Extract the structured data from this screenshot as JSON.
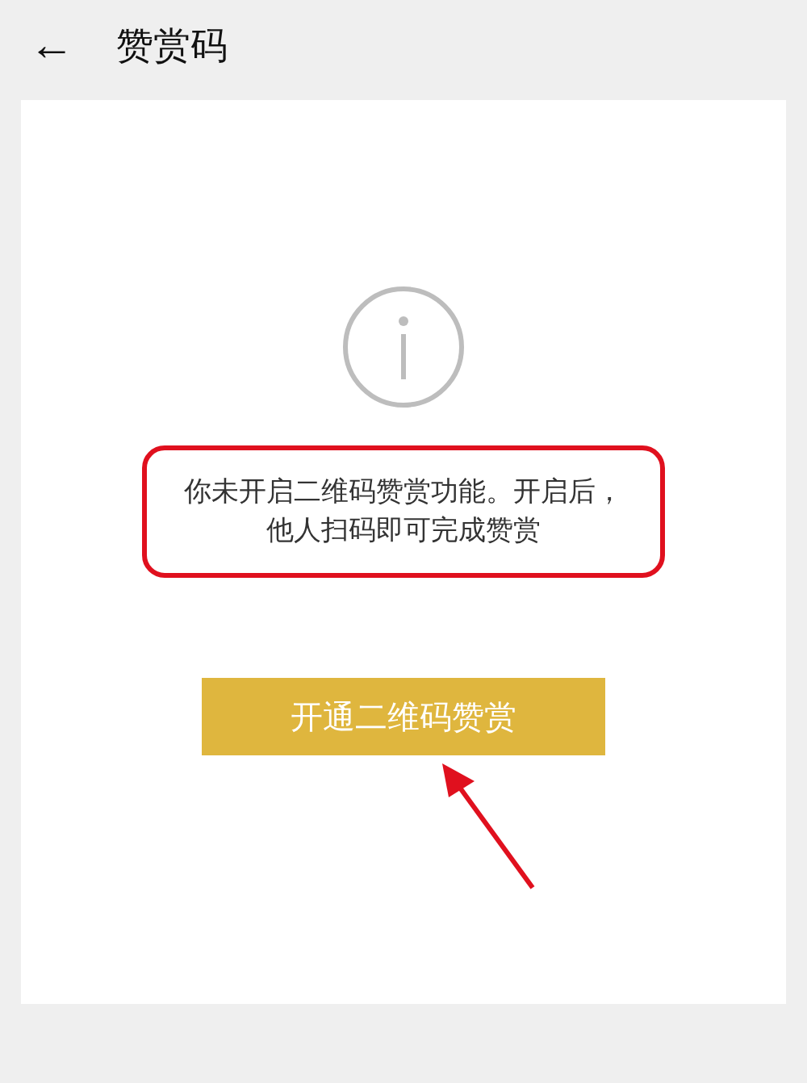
{
  "header": {
    "back": "←",
    "title": "赞赏码"
  },
  "notice": {
    "text": "你未开启二维码赞赏功能。开启后，他人扫码即可完成赞赏",
    "highlighted": true
  },
  "button": {
    "label": "开通二维码赞赏"
  },
  "pointer_arrow": true
}
